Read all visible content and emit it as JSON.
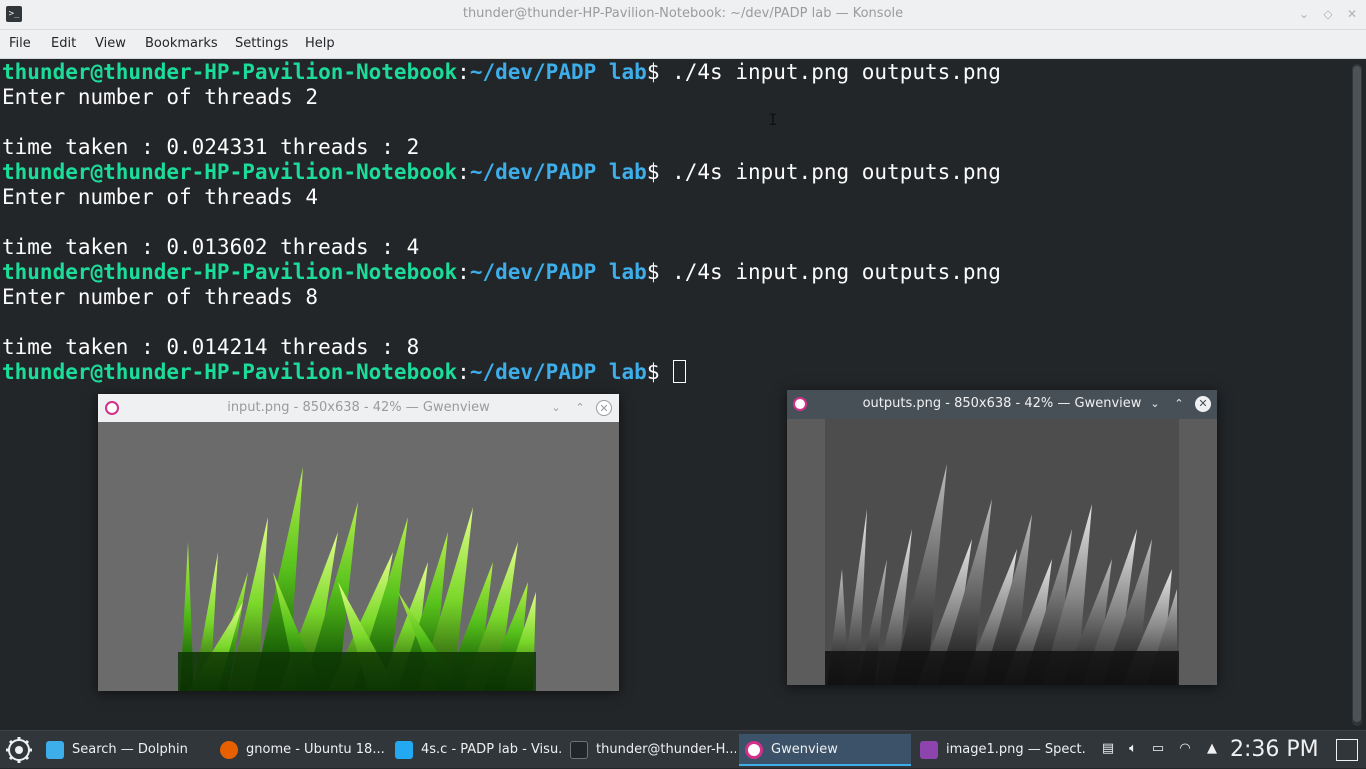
{
  "window": {
    "title": "thunder@thunder-HP-Pavilion-Notebook: ~/dev/PADP lab — Konsole",
    "icon": "konsole-icon",
    "controls": [
      "minimize-icon",
      "keep-above-icon",
      "close-icon"
    ]
  },
  "menubar": [
    "File",
    "Edit",
    "View",
    "Bookmarks",
    "Settings",
    "Help"
  ],
  "terminal": {
    "prompt_user": "thunder@thunder-HP-Pavilion-Notebook",
    "prompt_sep": ":",
    "prompt_path": "~/dev/PADP lab",
    "prompt_end": "$ ",
    "command": "./4s input.png outputs.png",
    "runs": [
      {
        "input_line": "Enter number of threads 2",
        "result_line": "time taken : 0.024331 threads : 2"
      },
      {
        "input_line": "Enter number of threads 4",
        "result_line": "time taken : 0.013602 threads : 4"
      },
      {
        "input_line": "Enter number of threads 8",
        "result_line": "time taken : 0.014214 threads : 8"
      }
    ]
  },
  "gwenview_input": {
    "title": "input.png - 850x638 - 42% — Gwenview",
    "image": "green-grass-image",
    "close_symbol": "✕",
    "min_symbol": "⌄",
    "max_symbol": "⌃"
  },
  "gwenview_output": {
    "title": "outputs.png - 850x638 - 42% — Gwenview",
    "image": "grayscale-grass-image",
    "close_symbol": "✕",
    "min_symbol": "⌄",
    "max_symbol": "⌃"
  },
  "taskbar": {
    "tasks": [
      {
        "label": "Search — Dolphin",
        "icon": "dolphin-icon",
        "color": "#3daee9"
      },
      {
        "label": "gnome - Ubuntu 18....",
        "icon": "firefox-icon",
        "color": "#e66000"
      },
      {
        "label": "4s.c - PADP lab - Visu...",
        "icon": "vscode-icon",
        "color": "#23a9f2"
      },
      {
        "label": "thunder@thunder-H...",
        "icon": "konsole-icon",
        "color": "#31363b"
      },
      {
        "label": "Gwenview",
        "icon": "gwenview-icon",
        "color": "#d2308a"
      },
      {
        "label": "image1.png — Spect...",
        "icon": "spectacle-icon",
        "color": "#8e44ad"
      }
    ],
    "active_task": "Gwenview",
    "clock": "2:36 PM",
    "tray": [
      "clipboard-icon",
      "volume-icon",
      "battery-icon",
      "wifi-icon",
      "tray-expand-icon"
    ]
  },
  "colors": {
    "prompt_user": "#1cdc9a",
    "prompt_path": "#3daee9",
    "terminal_bg": "#232629",
    "accent": "#3daee9"
  }
}
